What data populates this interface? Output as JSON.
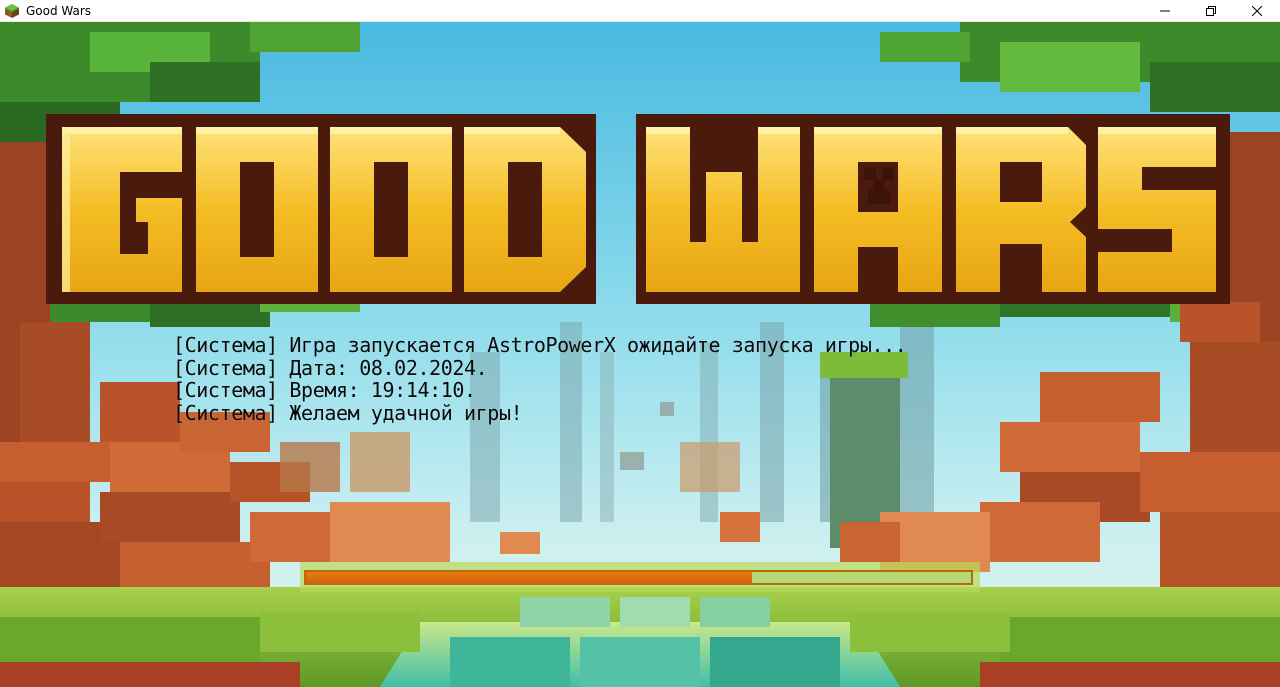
{
  "window": {
    "title": "Good Wars",
    "controls": [
      "minimize-icon",
      "restore-icon",
      "close-icon"
    ]
  },
  "game": {
    "logo_text": "GOOD WARS",
    "console": [
      "[Система] Игра запускается AstroPowerX ожидайте запуска игры...",
      "[Система] Дата: 08.02.2024.",
      "[Система] Время: 19:14:10.",
      "[Система] Желаем удачной игры!"
    ],
    "progress": {
      "value": 0.67
    }
  },
  "colors": {
    "sky": "#5fc8e6",
    "logo_fill": "#f5c22b",
    "logo_outline": "#5a1f10",
    "brick": "#b8522a",
    "grass": "#7bb636",
    "progress_fill": "#e57a12",
    "progress_border": "#b86a08"
  }
}
